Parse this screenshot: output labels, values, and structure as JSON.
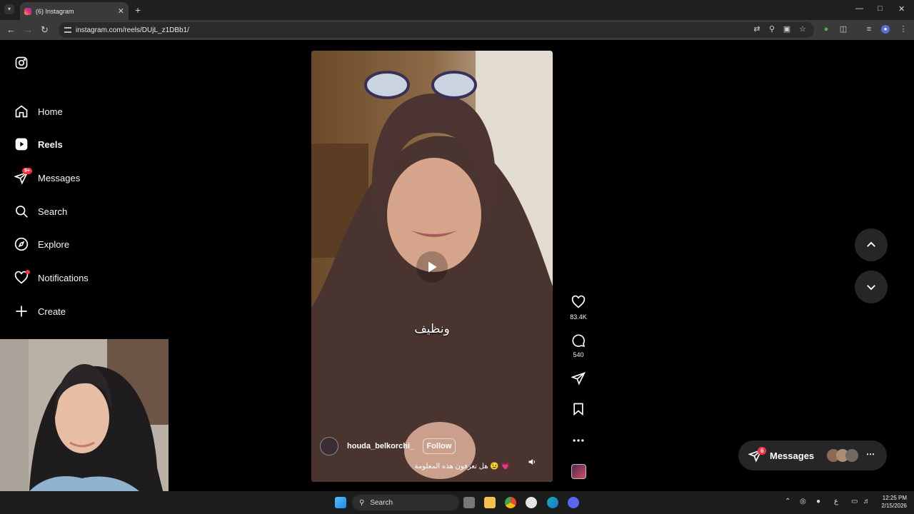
{
  "browser": {
    "tab_title": "(6) Instagram",
    "url": "instagram.com/reels/DUjL_z1DBb1/"
  },
  "sidebar": {
    "items": [
      {
        "label": "Home"
      },
      {
        "label": "Reels"
      },
      {
        "label": "Messages",
        "badge": "9+"
      },
      {
        "label": "Search"
      },
      {
        "label": "Explore"
      },
      {
        "label": "Notifications"
      },
      {
        "label": "Create"
      }
    ]
  },
  "reel": {
    "overlay_caption": "ونظيف",
    "username": "houda_belkorchi_",
    "follow_label": "Follow",
    "caption": "هل تعرفون هذه المعلومة 😉 💗"
  },
  "actions": {
    "likes": "83.4K",
    "comments": "540"
  },
  "messages_pill": {
    "label": "Messages",
    "badge": "6"
  },
  "taskbar": {
    "search_label": "Search",
    "time": "12:25 PM",
    "date": "2/15/2026"
  }
}
